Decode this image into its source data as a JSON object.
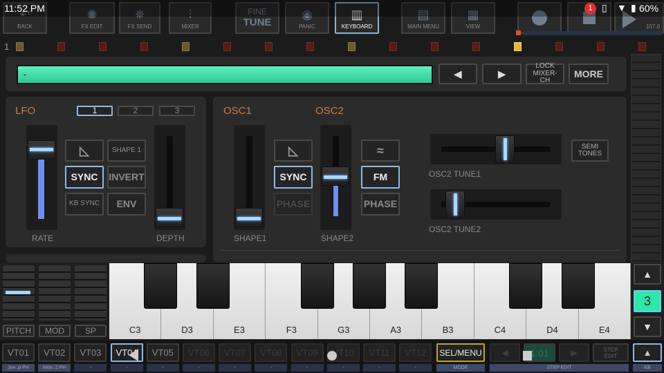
{
  "status_bar": {
    "time": "11:52 PM",
    "notification_count": "1",
    "battery": "60%"
  },
  "toolbar": {
    "buttons": [
      {
        "label": "BACK",
        "icon": "back-arrow-icon"
      },
      {
        "label": "FX EDIT",
        "icon": "fx-edit-icon"
      },
      {
        "label": "FX SEND",
        "icon": "fx-send-icon"
      },
      {
        "label": "MIXER",
        "icon": "mixer-icon"
      },
      {
        "label": "FINE",
        "label2": "TUNE",
        "icon": "none"
      },
      {
        "label": "PANIC",
        "icon": "panic-icon"
      },
      {
        "label": "KEYBOARD",
        "icon": "keyboard-icon",
        "selected": true
      },
      {
        "label": "MAIN MENU",
        "icon": "main-menu-icon"
      },
      {
        "label": "VIEW",
        "icon": "view-grid-icon"
      }
    ],
    "transport": {
      "record": "record-icon",
      "stop": "stop-icon",
      "play": "play-icon",
      "tempo": "107.0"
    }
  },
  "pattern_row": {
    "number": "1",
    "states": [
      "y",
      "r",
      "r",
      "r",
      "y",
      "r",
      "r",
      "r",
      "y",
      "r",
      "r",
      "r",
      "hot",
      "r",
      "r",
      "r"
    ]
  },
  "header": {
    "name_field": "-",
    "prev": "◀",
    "next": "▶",
    "lock": "LOCK MIXER-CH",
    "more": "MORE",
    "accent": "#3ddba8"
  },
  "lfo": {
    "title": "LFO",
    "tabs": [
      "1",
      "2",
      "3"
    ],
    "selected_tab": "1",
    "shape_btn": "SHAPE 1",
    "sync": "SYNC",
    "invert": "INVERT",
    "kb_sync": "KB SYNC",
    "env": "ENV",
    "rate_label": "RATE",
    "depth_label": "DEPTH",
    "rate": 0.8,
    "depth": 0.0
  },
  "osc": {
    "osc1_title": "OSC1",
    "osc2_title": "OSC2",
    "sync": "SYNC",
    "phase1": "PHASE",
    "fm": "FM",
    "phase2": "PHASE",
    "shape1_label": "SHAPE1",
    "shape2_label": "SHAPE2",
    "shape1": 0.0,
    "shape2": 0.45,
    "semitones": "SEMI TONES",
    "tune1_label": "OSC2 TUNE1",
    "tune2_label": "OSC2 TUNE2",
    "tune1": 0.6,
    "tune2": 0.2
  },
  "controllers": {
    "pitch": "PITCH",
    "mod": "MOD",
    "sp": "SP"
  },
  "keyboard": {
    "white_keys": [
      "C3",
      "D3",
      "E3",
      "F3",
      "G3",
      "A3",
      "B3",
      "C4",
      "D4",
      "E4"
    ],
    "octave": "3",
    "up": "▲",
    "down": "▼"
  },
  "tracks": {
    "items": [
      "VT01",
      "VT02",
      "VT03",
      "VT04",
      "VT05",
      "VT06",
      "VT07",
      "VT08",
      "VT09",
      "VT10",
      "VT11",
      "VT12"
    ],
    "subs": [
      "Jun..p PH",
      "Moo..2 PH",
      "-",
      "-",
      "-",
      "-",
      "-",
      "-",
      "-",
      "-",
      "-",
      "-"
    ],
    "selected": "VT04",
    "sel_menu": "SEL/MENU",
    "mode": "MODE",
    "position": "1:01",
    "step_edit": "STEP EDIT",
    "step_edit_sub": "STEP EDIT",
    "kb": "KB",
    "kb_up": "▲"
  }
}
